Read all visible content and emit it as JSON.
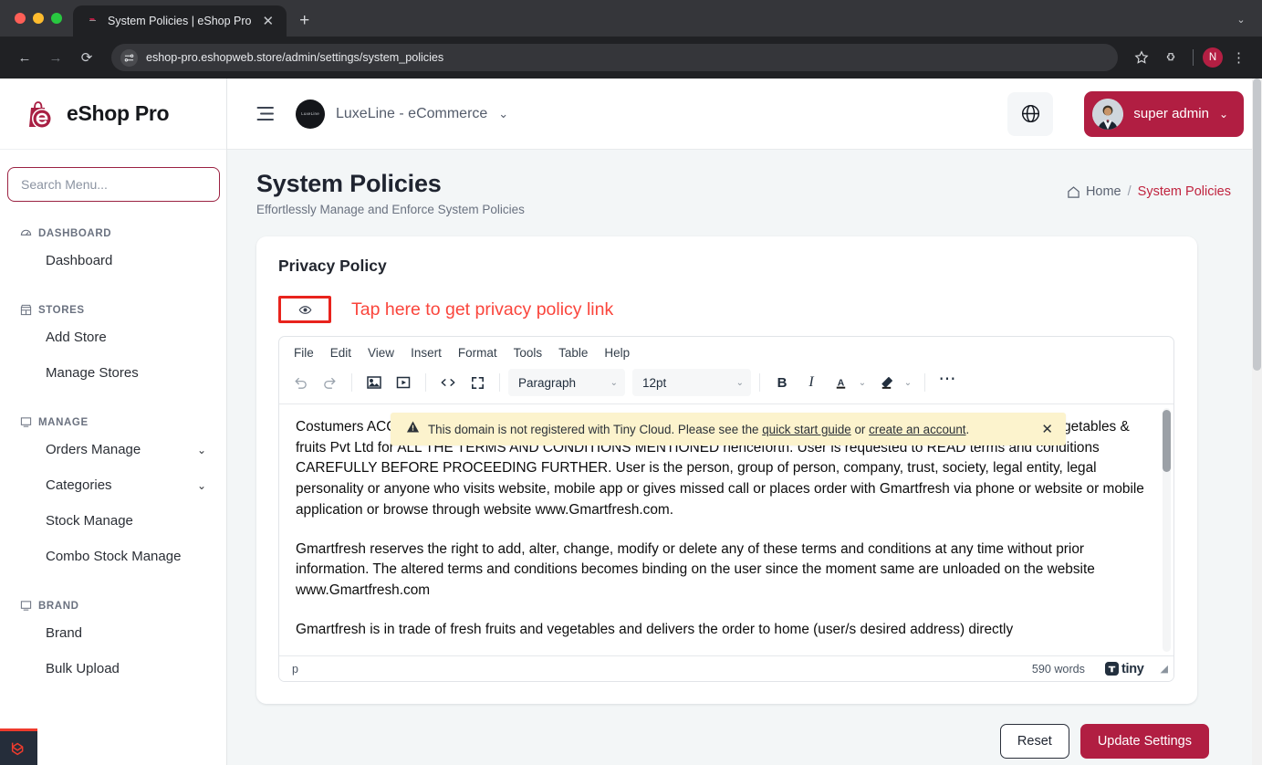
{
  "browser": {
    "tab_title": "System Policies | eShop Pro",
    "tab_close": "✕",
    "new_tab": "+",
    "tab_list_chevron": "⌄",
    "back": "←",
    "forward": "→",
    "reload": "⟳",
    "url": "eshop-pro.eshopweb.store/admin/settings/system_policies",
    "profile_initial": "N",
    "kebab": "⋮",
    "accent": "#b41f43"
  },
  "sidebar": {
    "brand": "eShop Pro",
    "search_placeholder": "Search Menu...",
    "search_value": "",
    "sections": [
      {
        "label": "DASHBOARD",
        "icon": "gauge-icon",
        "items": [
          {
            "label": "Dashboard",
            "expandable": false
          }
        ]
      },
      {
        "label": "STORES",
        "icon": "store-icon",
        "items": [
          {
            "label": "Add Store",
            "expandable": false
          },
          {
            "label": "Manage Stores",
            "expandable": false
          }
        ]
      },
      {
        "label": "MANAGE",
        "icon": "monitor-icon",
        "items": [
          {
            "label": "Orders Manage",
            "expandable": true
          },
          {
            "label": "Categories",
            "expandable": true
          },
          {
            "label": "Stock Manage",
            "expandable": false
          },
          {
            "label": "Combo Stock Manage",
            "expandable": false
          }
        ]
      },
      {
        "label": "BRAND",
        "icon": "monitor-icon",
        "items": [
          {
            "label": "Brand",
            "expandable": false
          },
          {
            "label": "Bulk Upload",
            "expandable": false
          }
        ]
      }
    ]
  },
  "topbar": {
    "store_name": "LuxeLine - eCommerce",
    "store_chevron": "⌄",
    "admin_label": "super admin",
    "admin_chevron": "⌄",
    "accent": "#b11e42"
  },
  "page": {
    "title": "System Policies",
    "subtitle": "Effortlessly Manage and Enforce System Policies",
    "breadcrumb": {
      "home": "Home",
      "separator": "/",
      "current": "System Policies"
    }
  },
  "card": {
    "title": "Privacy Policy",
    "annotation": "Tap here to get privacy policy link",
    "annotation_color": "#fa453c",
    "reset_label": "Reset",
    "update_label": "Update Settings"
  },
  "editor": {
    "menubar": [
      "File",
      "Edit",
      "View",
      "Insert",
      "Format",
      "Tools",
      "Table",
      "Help"
    ],
    "block_format": "Paragraph",
    "font_size": "12pt",
    "bold": "B",
    "italic": "I",
    "more": "…",
    "status_path": "p",
    "word_count": "590 words",
    "brand": "tiny",
    "notification": {
      "text_before": "This domain is not registered with Tiny Cloud. Please see the ",
      "link1": "quick start guide",
      "between": " or ",
      "link2": "create an account",
      "text_after": ".",
      "close": "✕",
      "bg": "#fcf3cd"
    },
    "paragraphs": [
      "Costumers ACCESSING or using website or mobile application INDICATES user is in AGREEMENT with cityecommerce vegetables & fruits Pvt Ltd for ALL THE TERMS AND CONDITIONS MENTIONED henceforth. User is requested to READ terms and conditions CAREFULLY BEFORE PROCEEDING FURTHER.\nUser is the person, group of person, company, trust, society, legal entity, legal personality or anyone who visits website, mobile app or gives missed call or places order with Gmartfresh via phone or website or mobile application or browse through website www.Gmartfresh.com.",
      "Gmartfresh reserves the right to add, alter, change, modify or delete any of these terms and conditions at any time without prior information. The altered terms and conditions becomes binding on the user since the moment same are unloaded on the website www.Gmartfresh.com",
      "Gmartfresh is in trade of fresh fruits and vegetables and delivers the order to home (user/s desired address) directly"
    ]
  }
}
